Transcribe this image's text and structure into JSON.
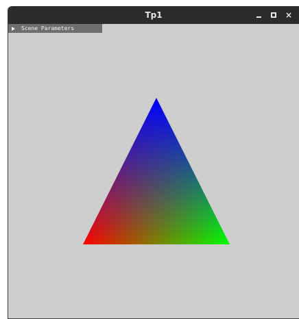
{
  "window": {
    "title": "Tp1",
    "close_glyph": "×"
  },
  "panel": {
    "label": "Scene Parameters",
    "icon": "collapse-triangle-icon"
  },
  "scene": {
    "background_color": "#cdcdcd",
    "vertex_colors": {
      "top": "#0000ff",
      "bottom_left": "#ff0000",
      "bottom_right": "#00ff00"
    }
  }
}
